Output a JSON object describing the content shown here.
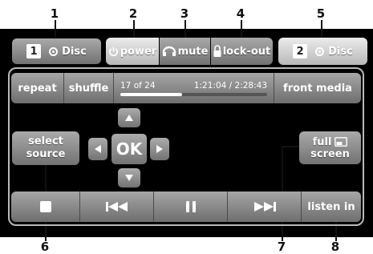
{
  "callouts": [
    "1",
    "2",
    "3",
    "4",
    "5",
    "6",
    "7",
    "8"
  ],
  "top_bar": {
    "disc1": {
      "badge": "1",
      "label": "Disc"
    },
    "power": {
      "label": "power"
    },
    "mute": {
      "label": "mute"
    },
    "lockout": {
      "label": "lock-out"
    },
    "disc2": {
      "badge": "2",
      "label": "Disc"
    }
  },
  "media_bar": {
    "repeat": "repeat",
    "shuffle": "shuffle",
    "track": "17 of 24",
    "time": "1:21:04 / 2:28:43",
    "progress": 0.42,
    "front_media": "front media"
  },
  "controls": {
    "select_source": [
      "select",
      "source"
    ],
    "ok": "OK",
    "full_screen": [
      "full",
      "screen"
    ]
  },
  "transport": {
    "listen_in": "listen in"
  },
  "colors": {
    "panel": "#000000",
    "button_top": "#a9a9a9",
    "button_bottom": "#727272",
    "active_top": "#ececec",
    "frame": "#b9b9b9"
  }
}
